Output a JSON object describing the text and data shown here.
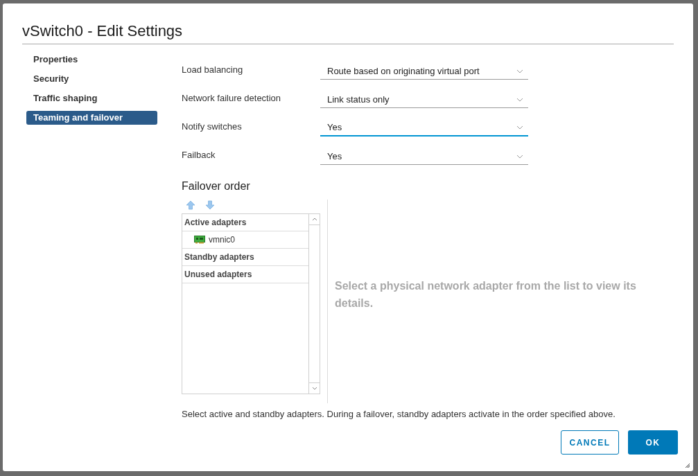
{
  "dialog": {
    "title": "vSwitch0 - Edit Settings"
  },
  "sidebar": {
    "items": [
      {
        "label": "Properties",
        "selected": false
      },
      {
        "label": "Security",
        "selected": false
      },
      {
        "label": "Traffic shaping",
        "selected": false
      },
      {
        "label": "Teaming and failover",
        "selected": true
      }
    ]
  },
  "fields": [
    {
      "label": "Load balancing",
      "value": "Route based on originating virtual port",
      "focused": false
    },
    {
      "label": "Network failure detection",
      "value": "Link status only",
      "focused": false
    },
    {
      "label": "Notify switches",
      "value": "Yes",
      "focused": true
    },
    {
      "label": "Failback",
      "value": "Yes",
      "focused": false
    }
  ],
  "failover_order": {
    "title": "Failover order",
    "groups": [
      {
        "label": "Active adapters",
        "children": [
          {
            "label": "vmnic0"
          }
        ]
      },
      {
        "label": "Standby adapters"
      },
      {
        "label": "Unused adapters"
      }
    ],
    "details_message": "Select a physical network adapter from the list to view its details.",
    "help_text": "Select active and standby adapters. During a failover, standby adapters activate in the order specified above."
  },
  "buttons": [
    {
      "label": "CANCEL",
      "kind": "secondary"
    },
    {
      "label": "OK",
      "kind": "primary"
    }
  ]
}
